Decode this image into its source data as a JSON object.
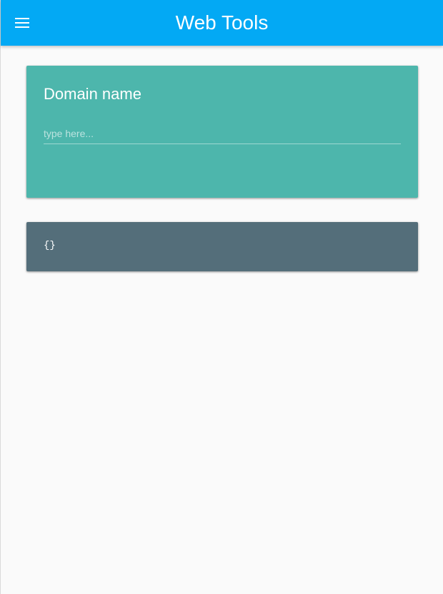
{
  "app": {
    "title": "Web Tools",
    "primary_color": "#03a9f4",
    "background_color": "#fafafa"
  },
  "toolbar": {
    "menu_icon": "menu-icon"
  },
  "domain_card": {
    "title": "Domain name",
    "input": {
      "value": "",
      "placeholder": "type here..."
    },
    "color": "#4db6ac"
  },
  "output_card": {
    "text": "{}",
    "color": "#546e7a"
  }
}
